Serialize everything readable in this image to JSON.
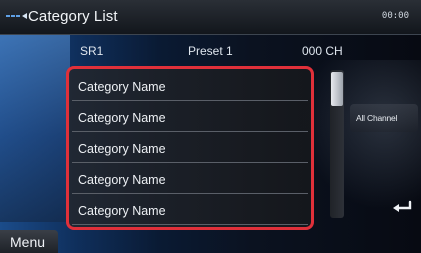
{
  "header": {
    "title": "Category List",
    "clock": "00:00"
  },
  "info_bar": {
    "band": "SR1",
    "preset": "Preset 1",
    "channel": "000 CH"
  },
  "category_list": {
    "items": [
      {
        "label": "Category Name"
      },
      {
        "label": "Category Name"
      },
      {
        "label": "Category Name"
      },
      {
        "label": "Category Name"
      },
      {
        "label": "Category Name"
      }
    ],
    "highlight_color": "#e0303a"
  },
  "side_buttons": {
    "all_channel": "All Channel"
  },
  "footer": {
    "menu": "Menu"
  },
  "icons": {
    "back": "back-arrow-icon",
    "return": "return-arrow-icon"
  }
}
